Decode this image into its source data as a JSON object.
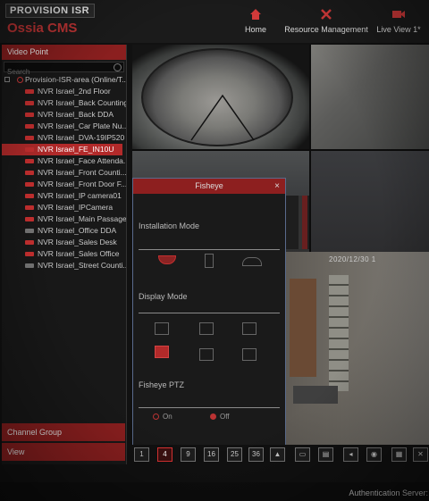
{
  "brand": {
    "logo": "PROVISION ISR",
    "product": "Ossia CMS"
  },
  "nav": {
    "home": "Home",
    "resource": "Resource Management",
    "live": "Live View 1*"
  },
  "sidebar": {
    "video_point_header": "Video Point",
    "search_placeholder": "Search",
    "root_label": "Provision-ISR-area (Online/T...",
    "items": [
      {
        "label": "NVR Israel_2nd Floor",
        "status": "online"
      },
      {
        "label": "NVR Israel_Back Counting",
        "status": "online"
      },
      {
        "label": "NVR Israel_Back DDA",
        "status": "online"
      },
      {
        "label": "NVR Israel_Car Plate Nu...",
        "status": "online"
      },
      {
        "label": "NVR Israel_DVA-19IP520",
        "status": "online"
      },
      {
        "label": "NVR Israel_FE_IN10U",
        "status": "online"
      },
      {
        "label": "NVR Israel_Face Attenda...",
        "status": "online"
      },
      {
        "label": "NVR Israel_Front Counti...",
        "status": "online"
      },
      {
        "label": "NVR Israel_Front Door F...",
        "status": "online"
      },
      {
        "label": "NVR Israel_IP camera01",
        "status": "online"
      },
      {
        "label": "NVR Israel_IPCamera",
        "status": "online"
      },
      {
        "label": "NVR Israel_Main Passage",
        "status": "online"
      },
      {
        "label": "NVR Israel_Office DDA",
        "status": "offline"
      },
      {
        "label": "NVR Israel_Sales Desk",
        "status": "online"
      },
      {
        "label": "NVR Israel_Sales Office",
        "status": "online"
      },
      {
        "label": "NVR Israel_Street Counti...",
        "status": "offline"
      }
    ],
    "selected_index": 5,
    "channel_group": "Channel Group",
    "view": "View"
  },
  "video": {
    "osd_timestamp": "2020/12/30 1"
  },
  "fisheye_dialog": {
    "title": "Fisheye",
    "close": "×",
    "installation_mode_label": "Installation Mode",
    "display_mode_label": "Display Mode",
    "ptz_label": "Fisheye PTZ",
    "ptz_on": "On",
    "ptz_off": "Off",
    "ptz_selected": "Off",
    "installation_modes": [
      "ceiling",
      "wall",
      "desktop"
    ],
    "installation_selected": "ceiling",
    "display_modes_selected": 3
  },
  "toolbar": {
    "layouts": [
      "1",
      "4",
      "9",
      "16",
      "25",
      "36"
    ],
    "selected_layout": "4"
  },
  "status_bar": {
    "text": "Authentication Server: Addr"
  },
  "colors": {
    "accent": "#b22a2a",
    "header": "#8b1f1f"
  }
}
